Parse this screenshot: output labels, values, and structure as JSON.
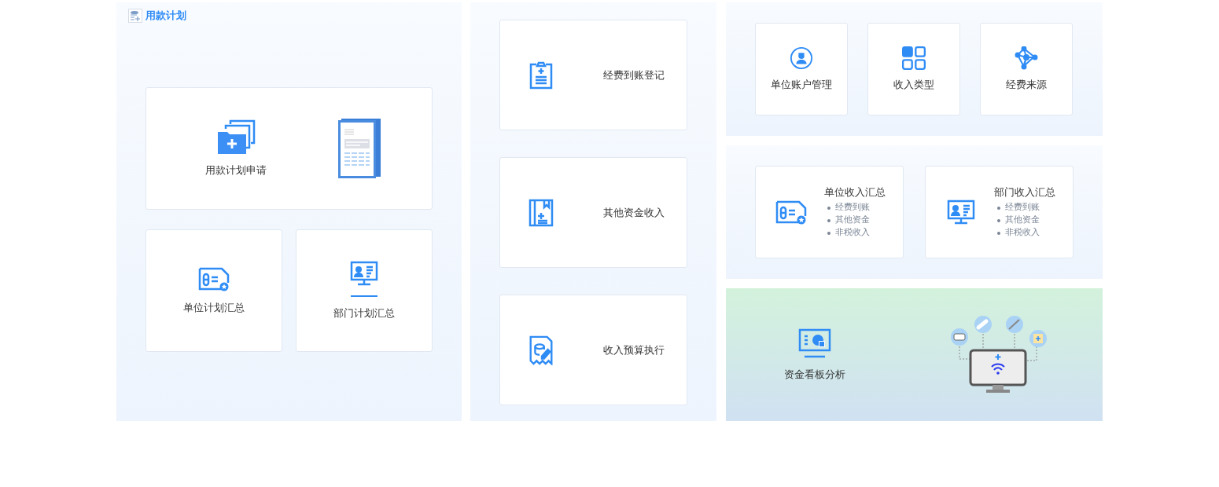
{
  "plan_panel": {
    "title": "用款计划",
    "apply_card": {
      "label": "用款计划申请"
    },
    "summary_cards": [
      {
        "label": "单位计划汇总",
        "kind": "card"
      },
      {
        "label": "部门计划汇总",
        "kind": "monitor"
      }
    ]
  },
  "income_panel": {
    "cards": [
      {
        "label": "经费到账登记",
        "kind": "clipboard"
      },
      {
        "label": "其他资金收入",
        "kind": "book"
      },
      {
        "label": "收入预算执行",
        "kind": "receipt"
      }
    ]
  },
  "settings": [
    {
      "label": "单位账户管理",
      "kind": "user"
    },
    {
      "label": "收入类型",
      "kind": "grid"
    },
    {
      "label": "经费来源",
      "kind": "network"
    }
  ],
  "income_summaries": [
    {
      "title": "单位收入汇总",
      "kind": "card",
      "items": [
        "经费到账",
        "其他资金",
        "非税收入"
      ]
    },
    {
      "title": "部门收入汇总",
      "kind": "monitor",
      "items": [
        "经费到账",
        "其他资金",
        "非税收入"
      ]
    }
  ],
  "dashboard": {
    "label": "资金看板分析"
  }
}
